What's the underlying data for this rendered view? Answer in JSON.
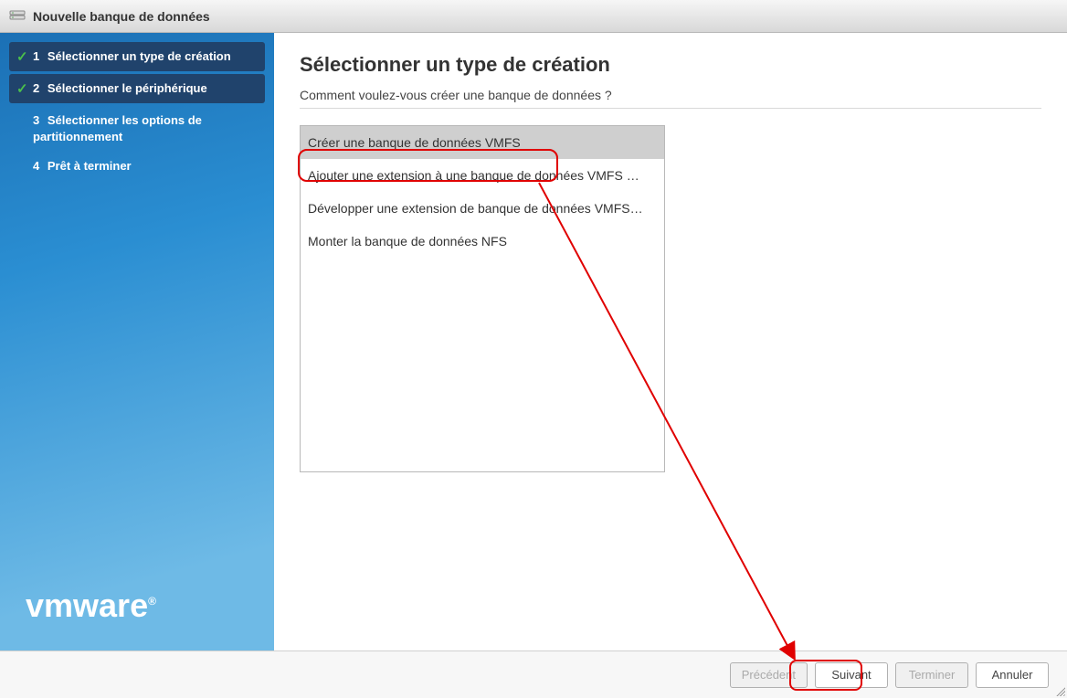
{
  "title": "Nouvelle banque de données",
  "steps": [
    {
      "num": "1",
      "label": "Sélectionner un type de création",
      "done": true,
      "active": true
    },
    {
      "num": "2",
      "label": "Sélectionner le périphérique",
      "done": true,
      "active": true
    },
    {
      "num": "3",
      "label": "Sélectionner les options de partitionnement",
      "done": false,
      "active": false
    },
    {
      "num": "4",
      "label": "Prêt à terminer",
      "done": false,
      "active": false
    }
  ],
  "brand": "vmware",
  "main": {
    "heading": "Sélectionner un type de création",
    "subtitle": "Comment voulez-vous créer une banque de données ?",
    "options": [
      "Créer une banque de données VMFS",
      "Ajouter une extension à une banque de données VMFS …",
      "Développer une extension de banque de données VMFS…",
      "Monter la banque de données NFS"
    ],
    "selected_index": 0
  },
  "footer": {
    "prev": "Précédent",
    "next": "Suivant",
    "finish": "Terminer",
    "cancel": "Annuler"
  }
}
